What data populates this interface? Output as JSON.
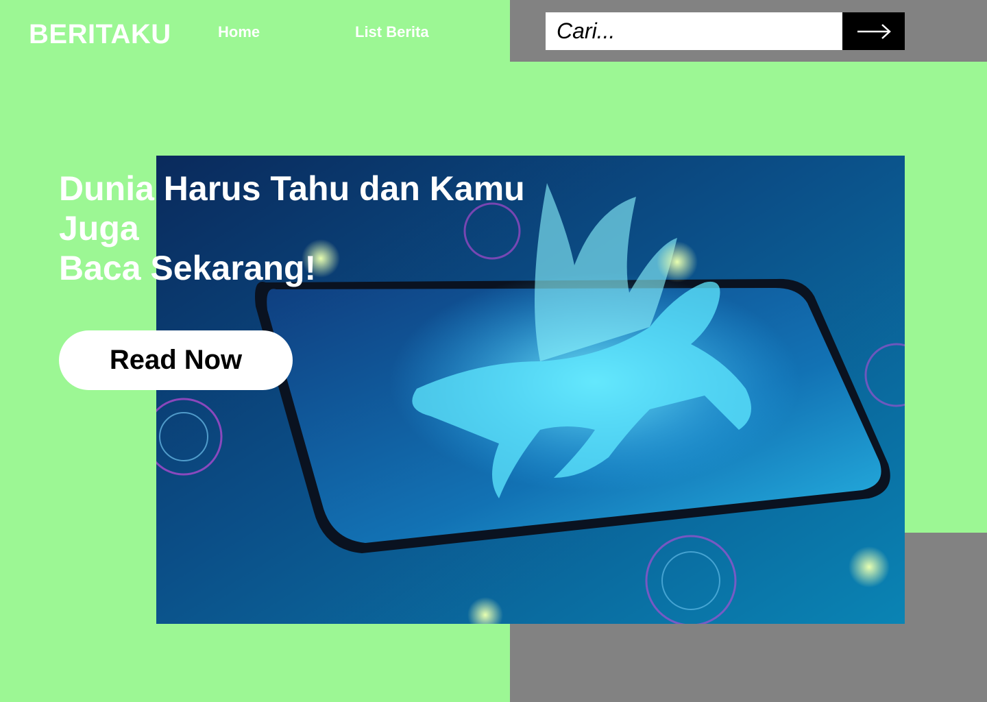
{
  "brand": {
    "name": "BERITAKU"
  },
  "nav": [
    {
      "label": "Home"
    },
    {
      "label": "List Berita"
    }
  ],
  "search": {
    "placeholder": "Cari...",
    "button_icon": "arrow-right-icon"
  },
  "hero": {
    "title_line1": "Dunia Harus Tahu dan Kamu Juga",
    "title_line2": "Baca Sekarang!",
    "cta_label": "Read Now",
    "image_description_icon": "pegasus-phone-image"
  },
  "colors": {
    "background": "#9cf794",
    "panel": "#828282",
    "text_light": "#ffffff",
    "button_dark": "#000000"
  }
}
